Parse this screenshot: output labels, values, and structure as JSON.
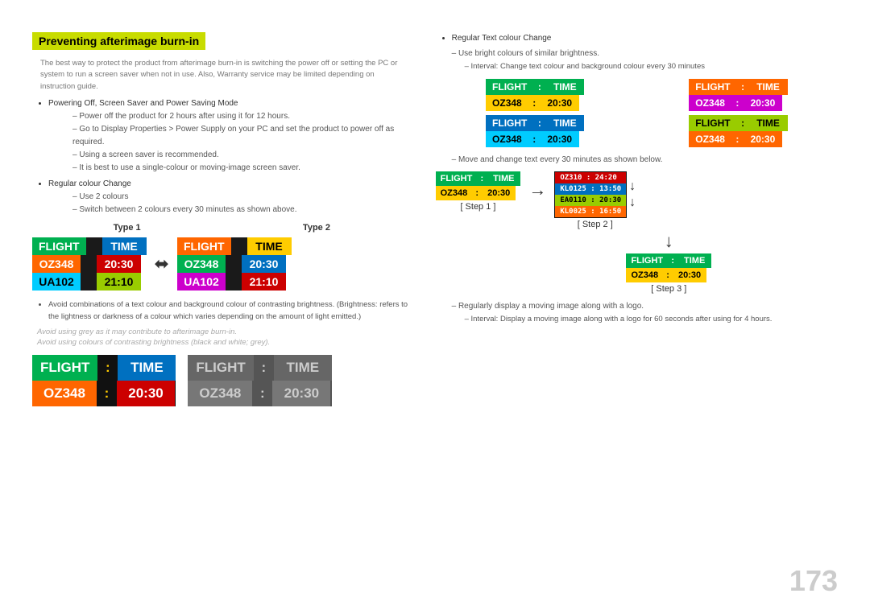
{
  "title": "Preventing afterimage burn-in",
  "page_number": "173",
  "left": {
    "intro_text": "The best way to protect the product from afterimage burn-in is switching the power off or setting the PC or system to run a screen saver when not in use. Also, Warranty service may be limited depending on instruction guide.",
    "bullets": [
      {
        "main": "Powering Off, Screen Saver and Power Saving Mode",
        "dashes": [
          "Power off the product for 2 hours after using it for 12 hours.",
          "Go to Display Properties > Power Supply on your PC and set the product to power off as required.",
          "Using a screen saver is recommended.",
          "It is best to use a single-colour or moving-image screen saver."
        ]
      },
      {
        "main": "Regular colour Change",
        "dashes": [
          "Use 2 colours",
          "Switch between 2 colours every 30 minutes as shown above."
        ]
      }
    ],
    "type1_label": "Type 1",
    "type2_label": "Type 2",
    "avoid_text1": "Avoid combinations of a text colour and background colour of contrasting brightness. (Brightness: refers to the lightness or darkness of a colour which varies depending on the amount of light emitted.)",
    "avoid_grey": "Avoid using grey as it may contribute to afterimage burn-in.",
    "avoid_contrast": "Avoid using colours of contrasting brightness (black and white; grey).",
    "bottom_board1": {
      "rows": [
        [
          {
            "text": "FLIGHT",
            "bg": "green"
          },
          {
            "text": ":",
            "bg": "dark"
          },
          {
            "text": "TIME",
            "bg": "blue"
          }
        ],
        [
          {
            "text": "OZ348",
            "bg": "orange"
          },
          {
            "text": ":",
            "bg": "dark"
          },
          {
            "text": "20:30",
            "bg": "red"
          }
        ]
      ]
    },
    "bottom_board2": {
      "rows": [
        [
          {
            "text": "FLIGHT",
            "bg": "gray-dark"
          },
          {
            "text": ":",
            "bg": "gray-dark"
          },
          {
            "text": "TIME",
            "bg": "gray-dark"
          }
        ],
        [
          {
            "text": "OZ348",
            "bg": "gray-dark"
          },
          {
            "text": ":",
            "bg": "gray-dark"
          },
          {
            "text": "20:30",
            "bg": "gray-dark"
          }
        ]
      ]
    }
  },
  "right": {
    "bullet_main": "Regular Text colour Change",
    "dash1": "Use bright colours of similar brightness.",
    "dash2_label": "Interval: Change text colour and background colour every 30 minutes",
    "boards_grid": [
      {
        "rows": [
          [
            {
              "text": "FLIGHT",
              "bg": "green"
            },
            {
              "text": " : ",
              "bg": "green"
            },
            {
              "text": "TIME",
              "bg": "green"
            }
          ],
          [
            {
              "text": "OZ348",
              "bg": "yellow",
              "color": "dark"
            },
            {
              "text": " : ",
              "bg": "yellow",
              "color": "dark"
            },
            {
              "text": "20:30",
              "bg": "yellow",
              "color": "dark"
            }
          ]
        ]
      },
      {
        "rows": [
          [
            {
              "text": "FLIGHT",
              "bg": "orange"
            },
            {
              "text": " : ",
              "bg": "orange"
            },
            {
              "text": "TIME",
              "bg": "orange"
            }
          ],
          [
            {
              "text": "OZ348",
              "bg": "magenta"
            },
            {
              "text": " : ",
              "bg": "magenta"
            },
            {
              "text": "20:30",
              "bg": "magenta"
            }
          ]
        ]
      },
      {
        "rows": [
          [
            {
              "text": "FLIGHT",
              "bg": "blue"
            },
            {
              "text": " : ",
              "bg": "blue"
            },
            {
              "text": "TIME",
              "bg": "blue"
            }
          ],
          [
            {
              "text": "OZ348",
              "bg": "cyan",
              "color": "dark"
            },
            {
              "text": " : ",
              "bg": "cyan",
              "color": "dark"
            },
            {
              "text": "20:30",
              "bg": "cyan",
              "color": "dark"
            }
          ]
        ]
      },
      {
        "rows": [
          [
            {
              "text": "FLIGHT",
              "bg": "lime"
            },
            {
              "text": " : ",
              "bg": "lime"
            },
            {
              "text": "TIME",
              "bg": "lime"
            }
          ],
          [
            {
              "text": "OZ348",
              "bg": "orange"
            },
            {
              "text": " : ",
              "bg": "orange"
            },
            {
              "text": "20:30",
              "bg": "orange"
            }
          ]
        ]
      }
    ],
    "move_text": "Move and change text every 30 minutes as shown below.",
    "step1_label": "[ Step 1 ]",
    "step2_label": "[ Step 2 ]",
    "step3_label": "[ Step 3 ]",
    "step1_board": {
      "rows": [
        [
          {
            "text": "FLIGHT",
            "bg": "green"
          },
          {
            "text": " : ",
            "bg": "green"
          },
          {
            "text": "TIME",
            "bg": "green"
          }
        ],
        [
          {
            "text": "OZ348",
            "bg": "yellow",
            "color": "dark"
          },
          {
            "text": " : ",
            "bg": "yellow",
            "color": "dark"
          },
          {
            "text": "20:30",
            "bg": "yellow",
            "color": "dark"
          }
        ]
      ]
    },
    "step2_board": {
      "rows": [
        [
          {
            "text": "OZ310 : 24:20",
            "bg": "red"
          }
        ],
        [
          {
            "text": "KL0125 : 13:50",
            "bg": "blue"
          }
        ],
        [
          {
            "text": "EA0110 : 20:30",
            "bg": "lime",
            "color": "dark"
          }
        ],
        [
          {
            "text": "KL0025 : 16:50",
            "bg": "orange"
          }
        ]
      ]
    },
    "step3_board": {
      "rows": [
        [
          {
            "text": "FLIGHT",
            "bg": "green"
          },
          {
            "text": " : ",
            "bg": "green"
          },
          {
            "text": "TIME",
            "bg": "green"
          }
        ],
        [
          {
            "text": "OZ348",
            "bg": "yellow",
            "color": "dark"
          },
          {
            "text": " : ",
            "bg": "yellow",
            "color": "dark"
          },
          {
            "text": "20:30",
            "bg": "yellow",
            "color": "dark"
          }
        ]
      ]
    },
    "regularly_text": "Regularly display a moving image along with a logo.",
    "regularly_interval": "Interval: Display a moving image along with a logo for 60 seconds after using for 4 hours."
  }
}
